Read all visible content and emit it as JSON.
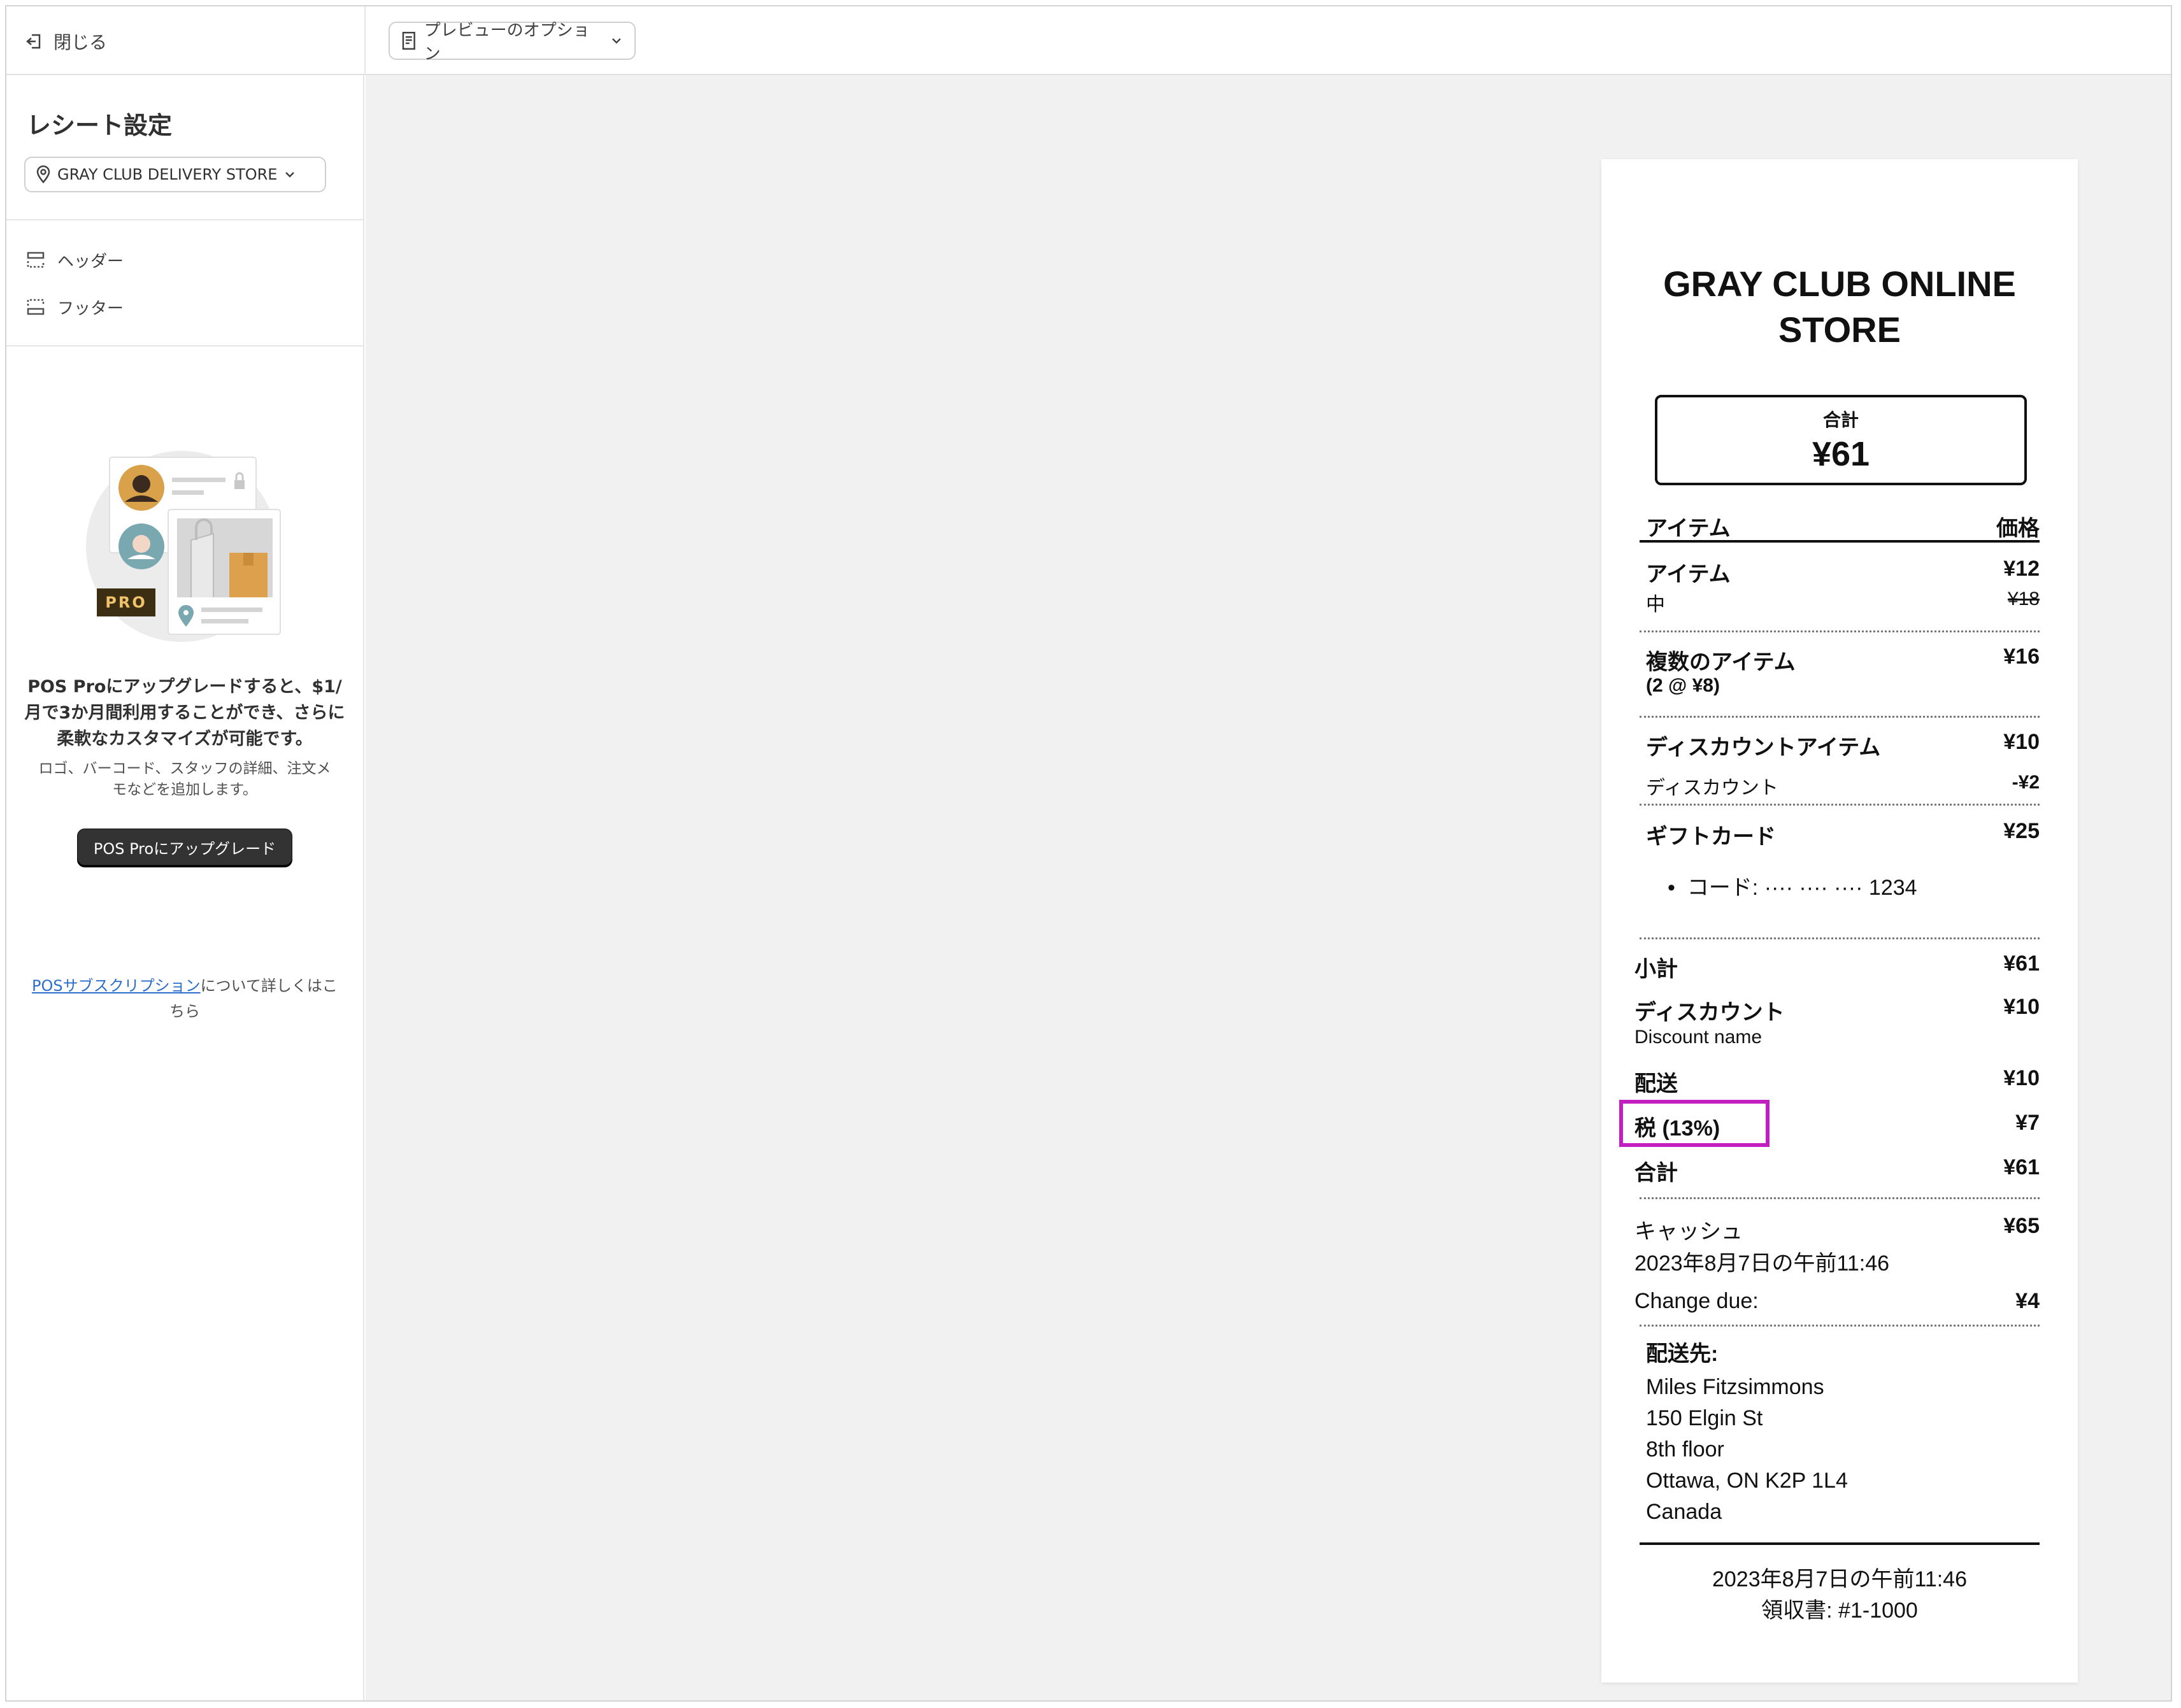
{
  "topbar": {
    "close_label": "閉じる",
    "preview_label": "プレビューのオプション"
  },
  "sidebar": {
    "title": "レシート設定",
    "store": "GRAY CLUB DELIVERY STORE",
    "nav": [
      {
        "label": "ヘッダー",
        "icon": "header-layout-icon"
      },
      {
        "label": "フッター",
        "icon": "footer-layout-icon"
      }
    ],
    "promo": {
      "badge": "PRO",
      "headline": "POS Proにアップグレードすると、$1/月で3か月間利用することができ、さらに柔軟なカスタマイズが可能です。",
      "sub": "ロゴ、バーコード、スタッフの詳細、注文メモなどを追加します。",
      "button": "POS Proにアップグレード"
    },
    "learn_link": "POSサブスクリプション",
    "learn_rest": "について詳しくはこちら"
  },
  "receipt": {
    "store_name": "GRAY CLUB ONLINE STORE",
    "total_label": "合計",
    "total_value": "¥61",
    "header_item": "アイテム",
    "header_price": "価格",
    "items": [
      {
        "name": "アイテム",
        "price": "¥12",
        "sub": "中",
        "sub_price": "¥18"
      },
      {
        "name": "複数のアイテム",
        "price": "¥16",
        "sub": "(2 @ ¥8)"
      },
      {
        "name": "ディスカウントアイテム",
        "price": "¥10",
        "sub": "ディスカウント",
        "sub_price": "-¥2"
      },
      {
        "name": "ギフトカード",
        "price": "¥25",
        "sub": "コード: ···· ···· ···· 1234"
      }
    ],
    "subtotal_label": "小計",
    "subtotal_value": "¥61",
    "discount_label": "ディスカウント",
    "discount_value": "¥10",
    "discount_name": "Discount name",
    "shipping_label": "配送",
    "shipping_value": "¥10",
    "tax_label": "税 (13%)",
    "tax_value": "¥7",
    "total2_label": "合計",
    "total2_value": "¥61",
    "payment_label": "キャッシュ",
    "payment_value": "¥65",
    "payment_date": "2023年8月7日の午前11:46",
    "change_label": "Change due:",
    "change_value": "¥4",
    "ship_to_label": "配送先:",
    "address": [
      "Miles Fitzsimmons",
      "150 Elgin St",
      "8th floor",
      "Ottawa, ON K2P 1L4",
      "Canada"
    ],
    "footer_date": "2023年8月7日の午前11:46",
    "receipt_no": "領収書: #1-1000"
  },
  "colors": {
    "highlight": "#c21fc0",
    "link": "#2c6ecb",
    "canvas": "#f1f1f1"
  }
}
